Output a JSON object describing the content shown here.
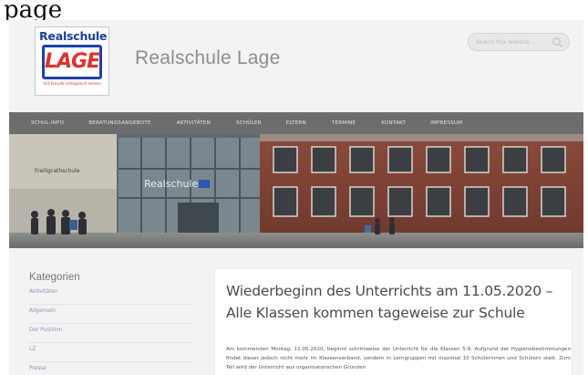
{
  "top_caption": "page",
  "header": {
    "logo": {
      "school": "Realschule",
      "mark": "LAGE",
      "tagline": "mit Freude erfolgreich lernen"
    },
    "title": "Realschule Lage",
    "search": {
      "placeholder": "Search this website..."
    }
  },
  "nav": {
    "items": [
      "SCHUL-INFO",
      "BERATUNGSANGEBOTE",
      "AKTIVITÄTEN",
      "SCHÜLER",
      "ELTERN",
      "TERMINE",
      "KONTAKT",
      "IMPRESSUM"
    ]
  },
  "banner": {
    "sign_left": "Freiligrathschule",
    "sign_main": "Realschule"
  },
  "sidebar": {
    "title": "Kategorien",
    "categories": [
      "Aktivitäten",
      "Allgemein",
      "Der Postillon",
      "LZ",
      "Presse"
    ]
  },
  "post": {
    "title": "Wiederbeginn des Unterrichts am 11.05.2020 – Alle Klassen kommen tageweise zur Schule",
    "body": "Am kommenden Montag, 11.05.2020, beginnt schrittweise der Unterricht für die Klassen 5-9. Aufgrund der Hygienebestimmungen findet dieser jedoch nicht mehr im Klassenverband, sondern in Lerngruppen mit maximal 10 Schülerinnen und Schülern statt. Zum Teil wird der Unterricht aus organisatorischen Gründen"
  },
  "colors": {
    "nav_bg": "#6d6d6d",
    "page_bg": "#f3f3f3",
    "logo_blue": "#1e40b0",
    "logo_red": "#e4302b",
    "title_gray": "#8e8e8e",
    "link_blue": "#8a95b8"
  }
}
